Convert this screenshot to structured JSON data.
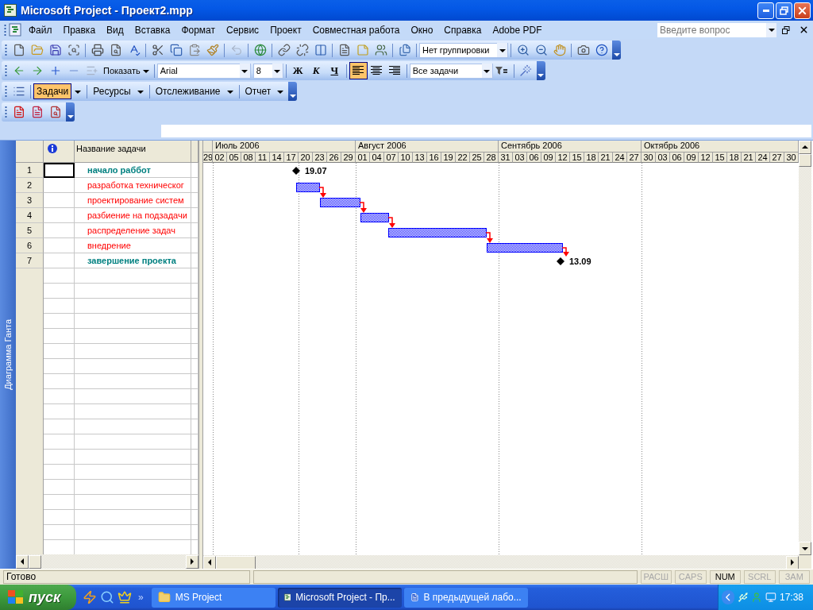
{
  "window": {
    "title": "Microsoft Project - Проект2.mpp"
  },
  "menu": {
    "items": [
      "Файл",
      "Правка",
      "Вид",
      "Вставка",
      "Формат",
      "Сервис",
      "Проект",
      "Совместная работа",
      "Окно",
      "Справка",
      "Adobe PDF"
    ],
    "help_field": {
      "placeholder": "Введите вопрос"
    }
  },
  "standard_toolbar": {
    "undo": {
      "disabled": true
    },
    "grouping": {
      "value": "Нет группировки"
    }
  },
  "formatting_toolbar": {
    "show_subtasks": {
      "disabled": true
    },
    "show_button": {
      "label": "Показать"
    },
    "font": {
      "value": "Arial"
    },
    "size": {
      "value": "8"
    },
    "style_buttons": [
      {
        "label": "Ж"
      },
      {
        "label": "К"
      },
      {
        "label": "Ч"
      }
    ],
    "align_buttons": [
      {
        "selected": true
      },
      {
        "selected": false
      },
      {
        "selected": false
      }
    ],
    "filter": {
      "value": "Все задачи"
    }
  },
  "guide_toolbar": {
    "items": [
      {
        "label": "Задачи",
        "selected": true
      },
      {
        "label": "Ресурсы",
        "selected": false
      },
      {
        "label": "Отслеживание",
        "selected": false
      },
      {
        "label": "Отчет",
        "selected": false
      }
    ]
  },
  "view_bar": {
    "label": "Диаграмма Ганта"
  },
  "task_table": {
    "columns": [
      "Название задачи"
    ],
    "rows": [
      {
        "id": "1",
        "name": "начало раббот",
        "kind": "milestone",
        "selected": true,
        "date_label": "19.07"
      },
      {
        "id": "2",
        "name": "разработка техническог",
        "kind": "task",
        "selected": false
      },
      {
        "id": "3",
        "name": "проектирование систем",
        "kind": "task",
        "selected": false
      },
      {
        "id": "4",
        "name": "разбиение на подзадачи",
        "kind": "task",
        "selected": false
      },
      {
        "id": "5",
        "name": "распределение задач",
        "kind": "task",
        "selected": false
      },
      {
        "id": "6",
        "name": "внедрение",
        "kind": "task",
        "selected": false
      },
      {
        "id": "7",
        "name": "завершение проекта",
        "kind": "milestone",
        "selected": false,
        "date_label": "13.09"
      }
    ]
  },
  "timescale": {
    "lead_days": [
      "29"
    ],
    "months": [
      {
        "label": "Июль 2006",
        "days": [
          "02",
          "05",
          "08",
          "11",
          "14",
          "17",
          "20",
          "23",
          "26",
          "29"
        ]
      },
      {
        "label": "Август 2006",
        "days": [
          "01",
          "04",
          "07",
          "10",
          "13",
          "16",
          "19",
          "22",
          "25",
          "28"
        ]
      },
      {
        "label": "Сентябрь 2006",
        "days": [
          "31",
          "03",
          "06",
          "09",
          "12",
          "15",
          "18",
          "21",
          "24",
          "27"
        ]
      },
      {
        "label": "Октябрь 2006",
        "days": [
          "30",
          "03",
          "06",
          "09",
          "12",
          "15",
          "18",
          "21",
          "24",
          "27",
          "30"
        ]
      }
    ]
  },
  "status_bar": {
    "text": "Готово",
    "indicators": [
      {
        "label": "РАСШ",
        "on": false
      },
      {
        "label": "CAPS",
        "on": false
      },
      {
        "label": "NUM",
        "on": true
      },
      {
        "label": "SCRL",
        "on": false
      },
      {
        "label": "ЗАМ",
        "on": false
      }
    ]
  },
  "taskbar": {
    "start": "пуск",
    "more": "»",
    "buttons": [
      {
        "label": "MS Project",
        "selected": false
      },
      {
        "label": "Microsoft Project - Пр...",
        "selected": true
      },
      {
        "label": "В предыдущей лабо...",
        "selected": false
      }
    ],
    "clock": "17:38"
  }
}
